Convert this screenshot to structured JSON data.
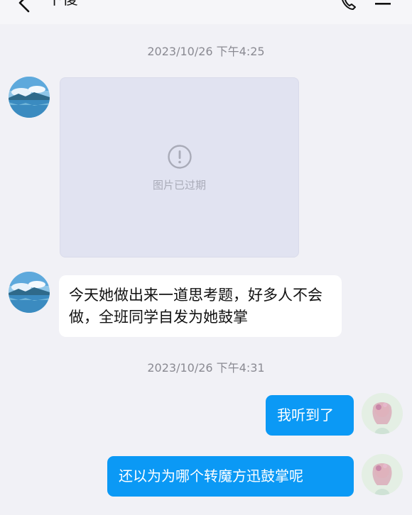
{
  "header": {
    "title": "下傻",
    "back_icon": "chevron-left-icon",
    "call_icon": "phone-icon",
    "menu_icon": "menu-icon"
  },
  "messages": {
    "timestamp_1": "2023/10/26 下午4:25",
    "image_expired_text": "图片已过期",
    "text_1": "今天她做出来一道思考题，好多人不会做，全班同学自发为她鼓掌",
    "timestamp_2": "2023/10/26 下午4:31",
    "out_1": "我听到了",
    "out_2": "还以为为哪个转魔方迅鼓掌呢"
  },
  "colors": {
    "background": "#f1f1f6",
    "outgoing_bubble": "#0b99f5",
    "incoming_bubble": "#ffffff",
    "expired_image_bg": "#e1e3f1"
  }
}
